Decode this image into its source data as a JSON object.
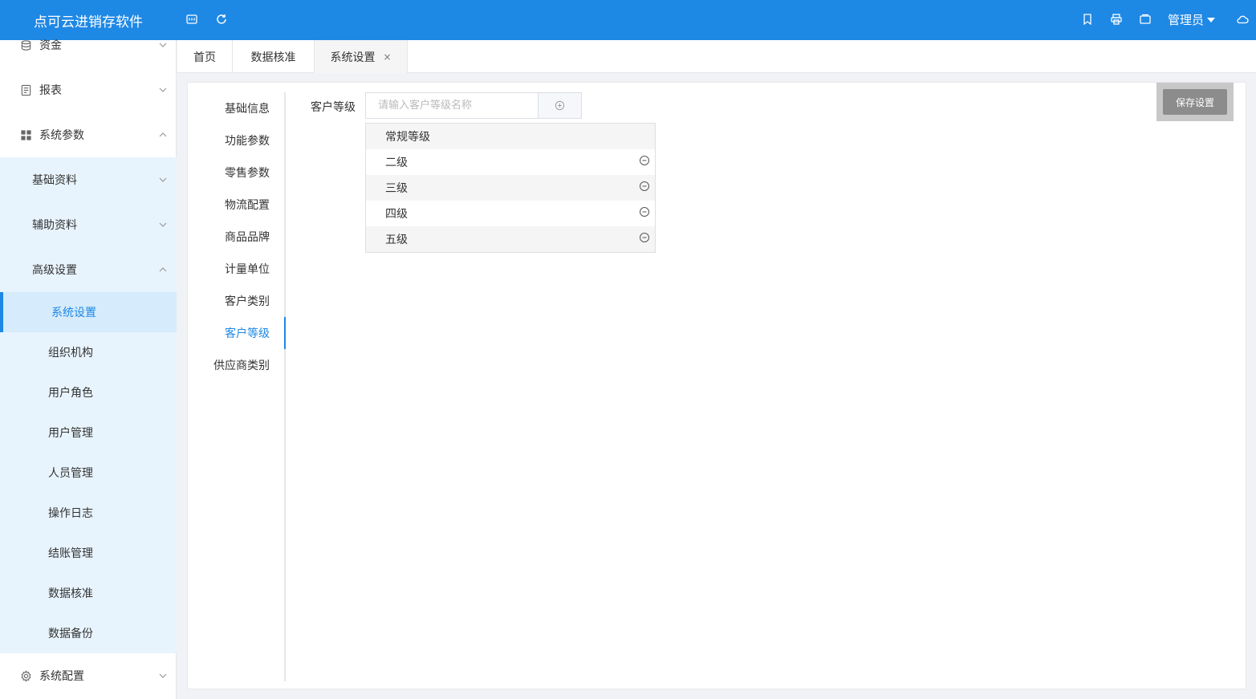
{
  "header": {
    "app_title": "点可云进销存软件",
    "user_label": "管理员",
    "icons": [
      "keyboard-icon",
      "refresh-icon",
      "bookmark-icon",
      "printer-icon",
      "window-icon",
      "cloud-icon"
    ]
  },
  "sidebar": {
    "items": [
      {
        "label": "资金",
        "icon": "database-icon"
      },
      {
        "label": "报表",
        "icon": "document-icon"
      },
      {
        "label": "系统参数",
        "icon": "grid-icon"
      },
      {
        "label": "系统配置",
        "icon": "gear-icon"
      }
    ],
    "sub_items": [
      {
        "label": "基础资料"
      },
      {
        "label": "辅助资料"
      },
      {
        "label": "高级设置"
      }
    ],
    "leaf_items": [
      {
        "label": "系统设置"
      },
      {
        "label": "组织机构"
      },
      {
        "label": "用户角色"
      },
      {
        "label": "用户管理"
      },
      {
        "label": "人员管理"
      },
      {
        "label": "操作日志"
      },
      {
        "label": "结账管理"
      },
      {
        "label": "数据核准"
      },
      {
        "label": "数据备份"
      }
    ]
  },
  "tabs": [
    {
      "label": "首页"
    },
    {
      "label": "数据核准"
    },
    {
      "label": "系统设置",
      "close": "×"
    }
  ],
  "settings_nav": [
    {
      "label": "基础信息"
    },
    {
      "label": "功能参数"
    },
    {
      "label": "零售参数"
    },
    {
      "label": "物流配置"
    },
    {
      "label": "商品品牌"
    },
    {
      "label": "计量单位"
    },
    {
      "label": "客户类别"
    },
    {
      "label": "客户等级"
    },
    {
      "label": "供应商类别"
    }
  ],
  "customer_level": {
    "field_label": "客户等级",
    "placeholder": "请输入客户等级名称",
    "levels": [
      {
        "label": "常规等级"
      },
      {
        "label": "二级"
      },
      {
        "label": "三级"
      },
      {
        "label": "四级"
      },
      {
        "label": "五级"
      }
    ]
  },
  "save_button": "保存设置",
  "colors": {
    "primary": "#1e88e5",
    "sidebar_sub_bg": "#e8f4fd"
  }
}
